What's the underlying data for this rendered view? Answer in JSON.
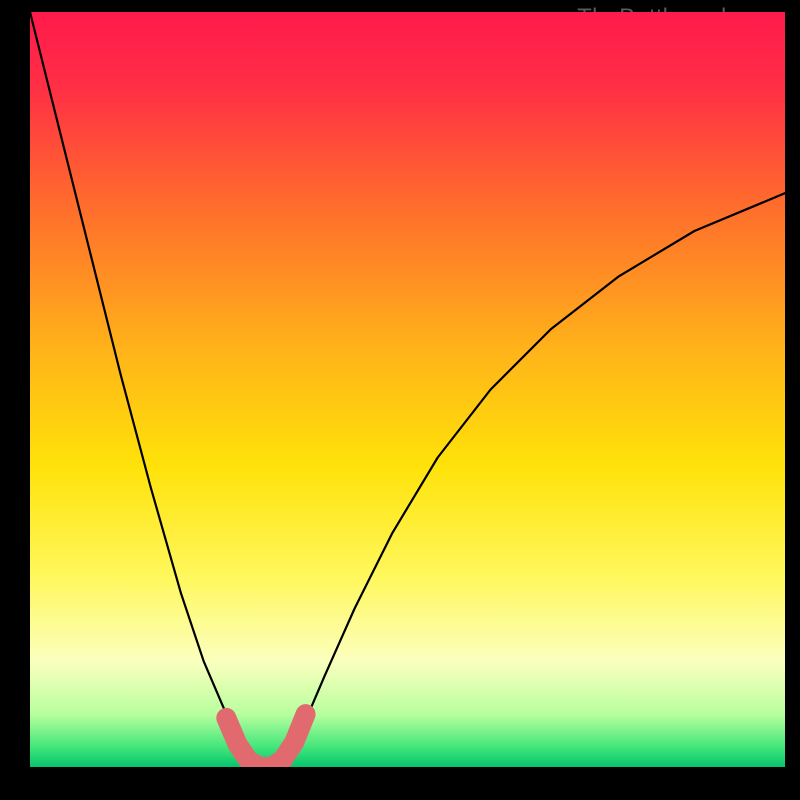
{
  "watermark": "TheBottleneck.com",
  "gradient": {
    "stops": [
      {
        "offset": 0.0,
        "color": "#ff1a4c"
      },
      {
        "offset": 0.1,
        "color": "#ff2f45"
      },
      {
        "offset": 0.25,
        "color": "#ff6a2d"
      },
      {
        "offset": 0.45,
        "color": "#ffb419"
      },
      {
        "offset": 0.6,
        "color": "#ffe209"
      },
      {
        "offset": 0.75,
        "color": "#fff85e"
      },
      {
        "offset": 0.86,
        "color": "#fbffbe"
      },
      {
        "offset": 0.93,
        "color": "#b8ff9e"
      },
      {
        "offset": 0.975,
        "color": "#3fe57a"
      },
      {
        "offset": 1.0,
        "color": "#07c36d"
      }
    ]
  },
  "chart_data": {
    "type": "line",
    "title": "",
    "xlabel": "",
    "ylabel": "",
    "xlim": [
      0,
      1
    ],
    "ylim": [
      0,
      1
    ],
    "series": [
      {
        "name": "bottleneck-curve",
        "x": [
          0.0,
          0.04,
          0.08,
          0.12,
          0.16,
          0.2,
          0.23,
          0.26,
          0.285,
          0.3,
          0.32,
          0.34,
          0.36,
          0.39,
          0.43,
          0.48,
          0.54,
          0.61,
          0.69,
          0.78,
          0.88,
          1.0
        ],
        "y": [
          1.0,
          0.84,
          0.68,
          0.52,
          0.37,
          0.23,
          0.14,
          0.07,
          0.02,
          0.0,
          0.0,
          0.015,
          0.05,
          0.12,
          0.21,
          0.31,
          0.41,
          0.5,
          0.58,
          0.65,
          0.71,
          0.76
        ]
      }
    ],
    "highlight": {
      "name": "valley",
      "color": "#e16a6f",
      "x": [
        0.26,
        0.275,
        0.29,
        0.305,
        0.32,
        0.335,
        0.35,
        0.365
      ],
      "y": [
        0.065,
        0.03,
        0.008,
        0.0,
        0.0,
        0.01,
        0.033,
        0.07
      ]
    }
  }
}
